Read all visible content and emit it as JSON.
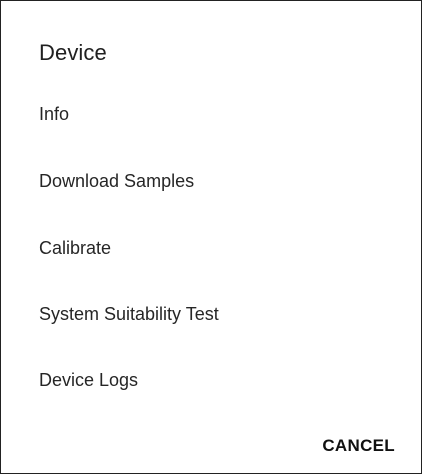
{
  "dialog": {
    "title": "Device",
    "items": [
      {
        "label": "Info"
      },
      {
        "label": "Download Samples"
      },
      {
        "label": "Calibrate"
      },
      {
        "label": "System Suitability Test"
      },
      {
        "label": "Device Logs"
      }
    ],
    "cancel_label": "CANCEL"
  }
}
